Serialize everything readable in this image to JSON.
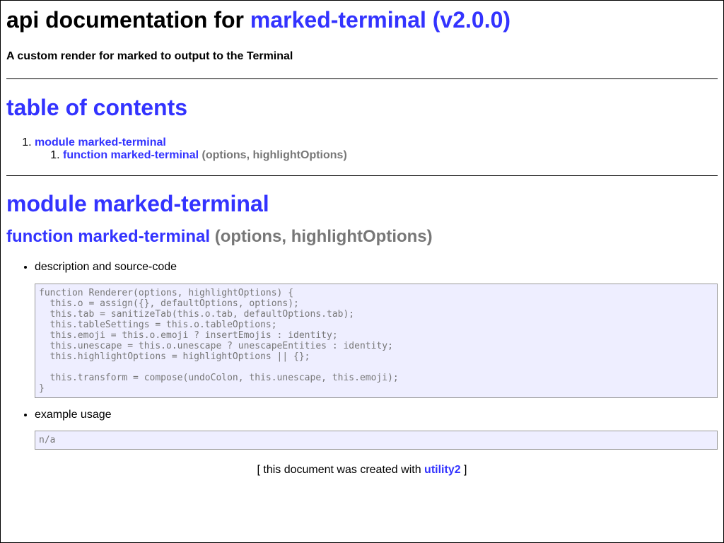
{
  "header": {
    "title_prefix": "api documentation for ",
    "title_link": "marked-terminal (v2.0.0)",
    "subtitle": "A custom render for marked to output to the Terminal"
  },
  "toc": {
    "heading": "table of contents",
    "items": [
      {
        "label": "module marked-terminal",
        "children": [
          {
            "label": "function marked-terminal",
            "args": "(options, highlightOptions)"
          }
        ]
      }
    ]
  },
  "module": {
    "heading": "module marked-terminal",
    "function": {
      "name": "function marked-terminal",
      "args": "(options, highlightOptions)",
      "description_label": "description and source-code",
      "source_code": "function Renderer(options, highlightOptions) {\n  this.o = assign({}, defaultOptions, options);\n  this.tab = sanitizeTab(this.o.tab, defaultOptions.tab);\n  this.tableSettings = this.o.tableOptions;\n  this.emoji = this.o.emoji ? insertEmojis : identity;\n  this.unescape = this.o.unescape ? unescapeEntities : identity;\n  this.highlightOptions = highlightOptions || {};\n\n  this.transform = compose(undoColon, this.unescape, this.emoji);\n}",
      "example_label": "example usage",
      "example_code": "n/a"
    }
  },
  "footer": {
    "prefix": "[ this document was created with ",
    "link": "utility2",
    "suffix": " ]"
  },
  "colors": {
    "link": "#3333ff",
    "muted": "#777777",
    "code_bg": "#eeeeff"
  }
}
